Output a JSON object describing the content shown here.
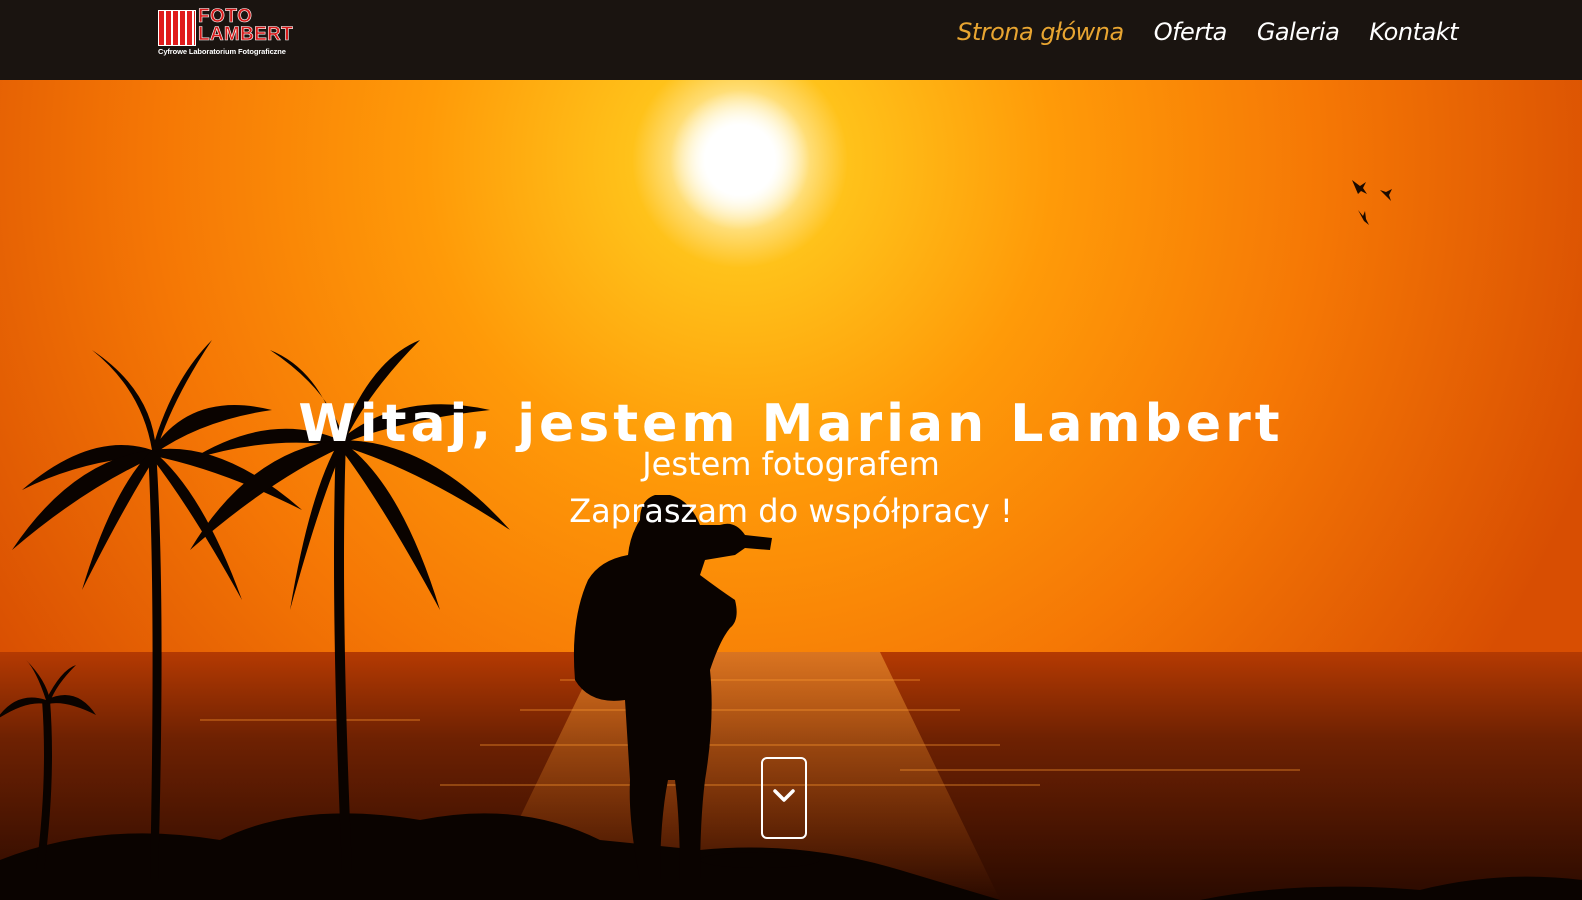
{
  "logo": {
    "line1": "FOTO",
    "line2": "LAMBERT",
    "tagline": "Cyfrowe Laboratorium Fotograficzne",
    "brand_color": "#d61a1a"
  },
  "nav": {
    "items": [
      {
        "label": "Strona główna",
        "active": true
      },
      {
        "label": "Oferta",
        "active": false
      },
      {
        "label": "Galeria",
        "active": false
      },
      {
        "label": "Kontakt",
        "active": false
      }
    ],
    "active_color": "#e8a531"
  },
  "hero": {
    "title": "Witaj, jestem Marian Lambert",
    "subtitle_line1": "Jestem fotografem",
    "subtitle_line2": "Zapraszam do współpracy !",
    "scroll_icon": "chevron-down-icon"
  }
}
